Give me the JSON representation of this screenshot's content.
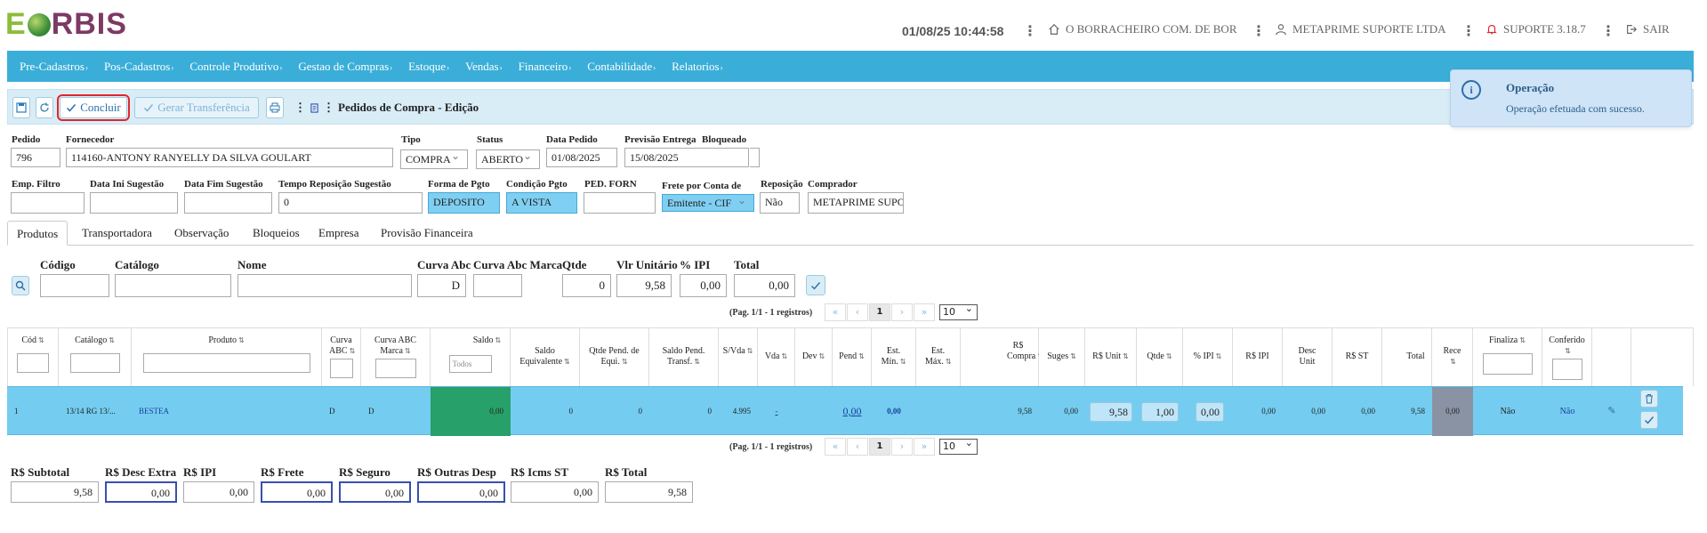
{
  "header": {
    "logo_first": "E",
    "logo_rest": "RBIS",
    "datetime": "01/08/25 10:44:58",
    "company": "O BORRACHEIRO COM. DE BOR",
    "user": "METAPRIME SUPORTE LTDA",
    "version": "SUPORTE 3.18.7",
    "logout": "SAIR"
  },
  "menu": [
    "Pre-Cadastros",
    "Pos-Cadastros",
    "Controle Produtivo",
    "Gestao de Compras",
    "Estoque",
    "Vendas",
    "Financeiro",
    "Contabilidade",
    "Relatorios"
  ],
  "toolbar": {
    "concluir": "Concluir",
    "transfer": "Gerar Transferência",
    "title": "Pedidos de Compra - Edição"
  },
  "toast": {
    "title": "Operação",
    "message": "Operação efetuada com sucesso."
  },
  "form": {
    "pedido_label": "Pedido",
    "pedido": "796",
    "fornecedor_label": "Fornecedor",
    "fornecedor": "114160-ANTONY RANYELLY DA SILVA GOULART",
    "tipo_label": "Tipo",
    "tipo": "COMPRA",
    "status_label": "Status",
    "status": "ABERTO",
    "data_pedido_label": "Data Pedido",
    "data_pedido": "01/08/2025",
    "previsao_label": "Previsão Entrega",
    "previsao": "15/08/2025",
    "bloqueado_label": "Bloqueado",
    "emp_filtro_label": "Emp. Filtro",
    "data_ini_label": "Data Ini Sugestão",
    "data_fim_label": "Data Fim Sugestão",
    "tempo_label": "Tempo Reposição Sugestão",
    "tempo": "0",
    "forma_pgto_label": "Forma de Pgto",
    "forma_pgto": "DEPOSITO",
    "condicao_label": "Condição Pgto",
    "condicao": "A VISTA",
    "ped_forn_label": "PED. FORN",
    "frete_label": "Frete por Conta de",
    "frete": "Emitente - CIF",
    "reposicao_label": "Reposição",
    "reposicao": "Não",
    "comprador_label": "Comprador",
    "comprador": "METAPRIME SUPORTE"
  },
  "tabs": [
    "Produtos",
    "Transportadora",
    "Observação",
    "Bloqueios",
    "Empresa",
    "Provisão Financeira"
  ],
  "filter": {
    "codigo": "Código",
    "catalogo": "Catálogo",
    "nome": "Nome",
    "curva_abc": "Curva Abc",
    "curva_abc_value": "D",
    "curva_marca": "Curva Abc Marca",
    "qtde": "Qtde",
    "qtde_value": "0",
    "vlr_unit": "Vlr Unitário",
    "vlr_unit_value": "9,58",
    "ipi": "% IPI",
    "ipi_value": "0,00",
    "total": "Total",
    "total_value": "0,00"
  },
  "pager": {
    "info": "(Pag. 1/1 - 1 registros)",
    "first": "«",
    "prev": "‹",
    "page": "1",
    "next": "›",
    "last": "»",
    "size": "10"
  },
  "grid": {
    "headers": [
      "Cód",
      "Catálogo",
      "Produto",
      "Curva ABC",
      "Curva ABC Marca",
      "Saldo",
      "Saldo Equivalente",
      "Qtde Pend. de Equi.",
      "Saldo Pend. Transf.",
      "S/Vda",
      "Vda",
      "Dev",
      "Pend",
      "Est. Mín.",
      "Est. Máx.",
      "R$ Compra",
      "Suges",
      "R$ Unit",
      "Qtde",
      "% IPI",
      "R$ IPI",
      "Desc Unit",
      "R$ ST",
      "Total",
      "Rece",
      "Finaliza",
      "Conferido"
    ],
    "saldo_filter": "Todos",
    "row": {
      "cod": "1",
      "catalogo": "13/14 RG 13/...",
      "produto": "BESTEA",
      "curva_abc": "D",
      "curva_marca": "D",
      "saldo": "0,00",
      "saldo_equiv": "0",
      "qtde_pend": "0",
      "saldo_transf": "0",
      "svda": "4.995",
      "vda": "-",
      "dev": "",
      "pend": "0,00",
      "est_min": "0,00",
      "est_max": "",
      "rs_compra": "9,58",
      "suges": "0,00",
      "rs_unit": "9,58",
      "qtde": "1,00",
      "ipi_pct": "0,00",
      "rs_ipi": "0,00",
      "desc_unit": "0,00",
      "rs_st": "0,00",
      "total": "9,58",
      "rece": "0,00",
      "finaliza": "Não",
      "conferido": "Não"
    }
  },
  "totals": {
    "subtotal_label": "R$ Subtotal",
    "subtotal": "9,58",
    "desc_extra_label": "R$ Desc Extra",
    "desc_extra": "0,00",
    "ipi_label": "R$ IPI",
    "ipi": "0,00",
    "frete_label": "R$ Frete",
    "frete": "0,00",
    "seguro_label": "R$ Seguro",
    "seguro": "0,00",
    "outras_label": "R$ Outras Desp",
    "outras": "0,00",
    "icms_label": "R$ Icms ST",
    "icms": "0,00",
    "total_label": "R$ Total",
    "total": "9,58"
  }
}
